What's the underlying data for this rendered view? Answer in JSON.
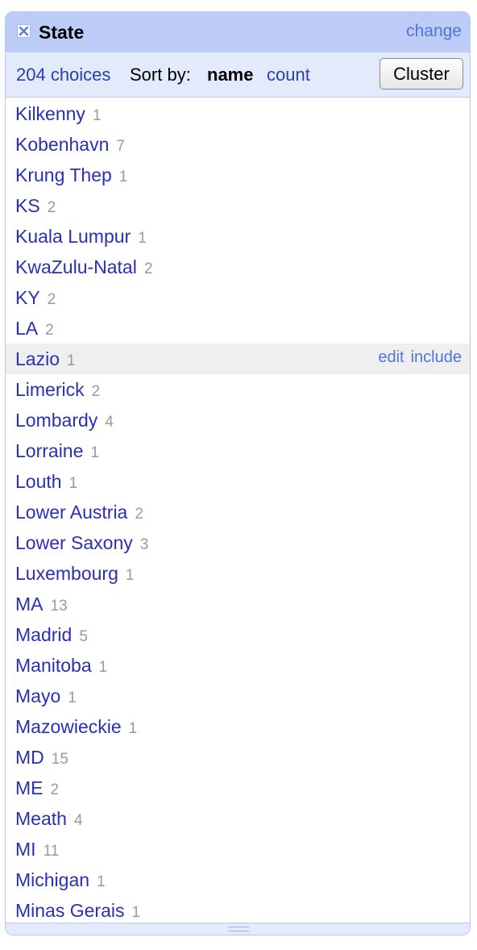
{
  "facet": {
    "title": "State",
    "change_label": "change",
    "choices_label": "204 choices",
    "sort_by_label": "Sort by:",
    "sort_name_label": "name",
    "sort_count_label": "count",
    "cluster_label": "Cluster",
    "hover_actions": {
      "edit_label": "edit",
      "include_label": "include"
    },
    "choices": [
      {
        "name": "Kilkenny",
        "count": "1"
      },
      {
        "name": "Kobenhavn",
        "count": "7"
      },
      {
        "name": "Krung Thep",
        "count": "1"
      },
      {
        "name": "KS",
        "count": "2"
      },
      {
        "name": "Kuala Lumpur",
        "count": "1"
      },
      {
        "name": "KwaZulu-Natal",
        "count": "2"
      },
      {
        "name": "KY",
        "count": "2"
      },
      {
        "name": "LA",
        "count": "2"
      },
      {
        "name": "Lazio",
        "count": "1",
        "hovered": true
      },
      {
        "name": "Limerick",
        "count": "2"
      },
      {
        "name": "Lombardy",
        "count": "4"
      },
      {
        "name": "Lorraine",
        "count": "1"
      },
      {
        "name": "Louth",
        "count": "1"
      },
      {
        "name": "Lower Austria",
        "count": "2"
      },
      {
        "name": "Lower Saxony",
        "count": "3"
      },
      {
        "name": "Luxembourg",
        "count": "1"
      },
      {
        "name": "MA",
        "count": "13"
      },
      {
        "name": "Madrid",
        "count": "5"
      },
      {
        "name": "Manitoba",
        "count": "1"
      },
      {
        "name": "Mayo",
        "count": "1"
      },
      {
        "name": "Mazowieckie",
        "count": "1"
      },
      {
        "name": "MD",
        "count": "15"
      },
      {
        "name": "ME",
        "count": "2"
      },
      {
        "name": "Meath",
        "count": "4"
      },
      {
        "name": "MI",
        "count": "11"
      },
      {
        "name": "Michigan",
        "count": "1"
      },
      {
        "name": "Minas Gerais",
        "count": "1"
      }
    ]
  }
}
